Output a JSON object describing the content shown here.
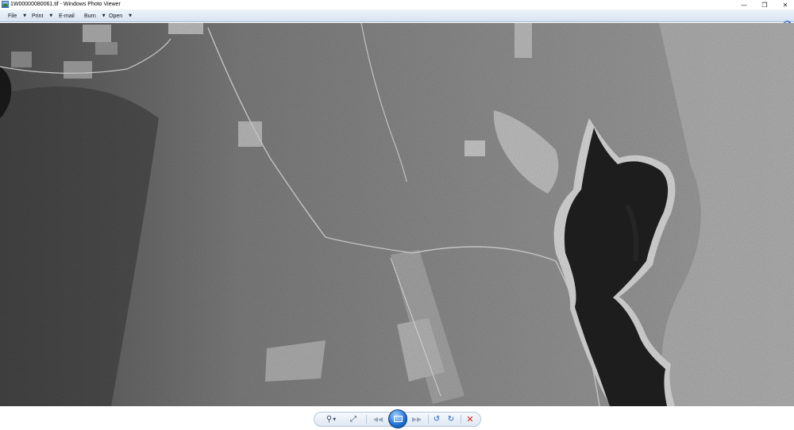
{
  "window": {
    "title": "1W00000080061.tif - Windows Photo Viewer",
    "controls": {
      "minimize": "—",
      "maximize": "❐",
      "close": "✕"
    }
  },
  "menu": [
    {
      "label": "File",
      "has_dropdown": true
    },
    {
      "label": "Print",
      "has_dropdown": true
    },
    {
      "label": "E-mail",
      "has_dropdown": false
    },
    {
      "label": "Burn",
      "has_dropdown": true
    },
    {
      "label": "Open",
      "has_dropdown": true
    }
  ],
  "menu_arrow": "▼",
  "help": {
    "label": "?"
  },
  "photo": {
    "description_icon": "aerial-photo",
    "palette": [
      "#6b6b6b",
      "#8a8a8a",
      "#bdbdbd",
      "#232323",
      "#d8d8d8"
    ]
  },
  "toolbar": {
    "zoom_icon": "⚲",
    "zoom_caret": "▼",
    "fit_icon": "⤢",
    "prev_icon": "◀◀",
    "next_icon": "▶▶",
    "rotate_left_icon": "↺",
    "rotate_right_icon": "↻",
    "delete_icon": "✕"
  },
  "colors": {
    "menu_bg": "#dce7f4",
    "slideshow_button": "#1d6fd1",
    "delete": "#d11a1a",
    "rotate": "#1d5fb3"
  }
}
